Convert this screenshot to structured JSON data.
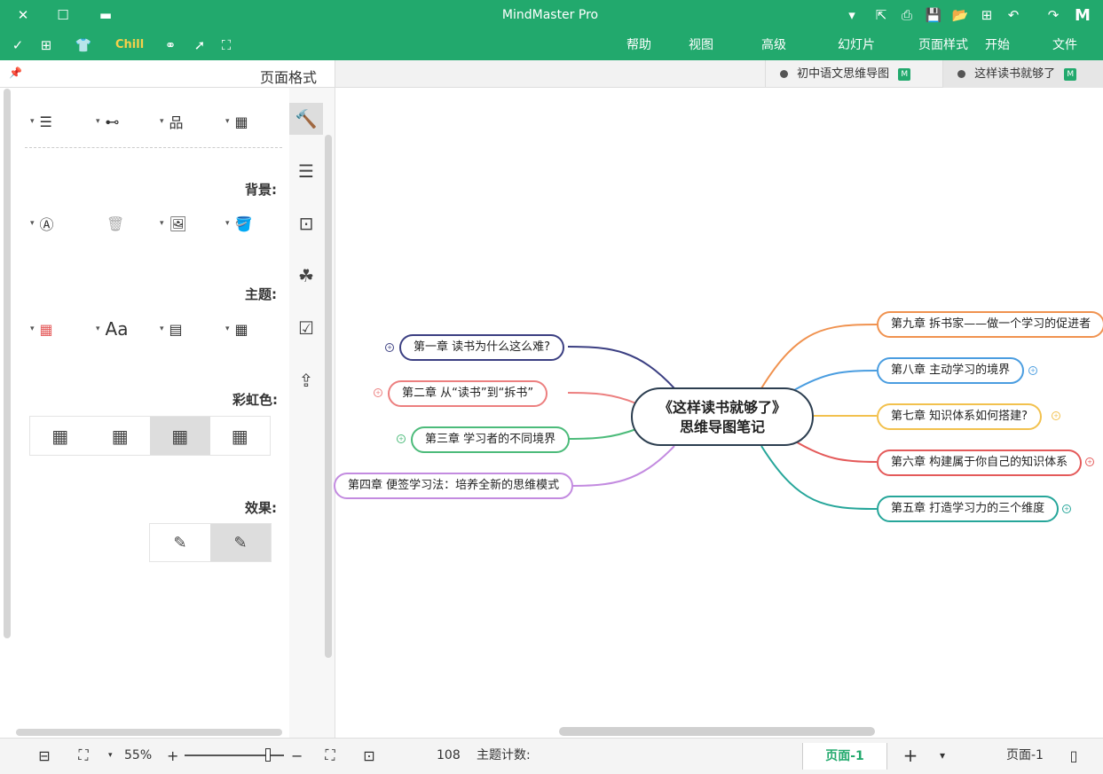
{
  "app": {
    "title": "MindMaster Pro",
    "chill_label": "Chill"
  },
  "menu": {
    "items": [
      "文件",
      "开始",
      "页面样式",
      "幻灯片",
      "高级",
      "视图",
      "帮助"
    ]
  },
  "tabs": {
    "panel_title": "页面格式",
    "doc_tabs": [
      {
        "label": "这样读书就够了",
        "active": true
      },
      {
        "label": "初中语文思维导图",
        "active": false
      }
    ]
  },
  "panel": {
    "background_label": "背景:",
    "theme_label": "主题:",
    "rainbow_label": "彩虹色:",
    "effect_label": "效果:",
    "font_label": "Aa"
  },
  "mindmap": {
    "central_line1": "《这样读书就够了》",
    "central_line2": "思维导图笔记",
    "right_nodes": [
      {
        "label": "第九章 拆书家——做一个学习的促进者",
        "color": "#f0924f"
      },
      {
        "label": "第八章 主动学习的境界",
        "color": "#4a9de0"
      },
      {
        "label": "第七章 知识体系如何搭建?",
        "color": "#f2c14e"
      },
      {
        "label": "第六章 构建属于你自己的知识体系",
        "color": "#e45a5a"
      },
      {
        "label": "第五章 打造学习力的三个维度",
        "color": "#26a69a"
      }
    ],
    "left_nodes": [
      {
        "label": "第一章 读书为什么这么难?",
        "color": "#3b3f82"
      },
      {
        "label": "第二章 从“读书”到“拆书”",
        "color": "#ec7f7f"
      },
      {
        "label": "第三章 学习者的不同境界",
        "color": "#4cbb7a"
      },
      {
        "label": "第四章 便签学习法：培养全新的思维模式",
        "color": "#c38be0"
      }
    ],
    "central_border": "#2c3e50"
  },
  "status": {
    "zoom": "55%",
    "topic_count_label": "主题计数:",
    "topic_count": "108",
    "page_tab": "页面-1",
    "page_select": "页面-1"
  },
  "colors": {
    "brand": "#22a96d"
  }
}
